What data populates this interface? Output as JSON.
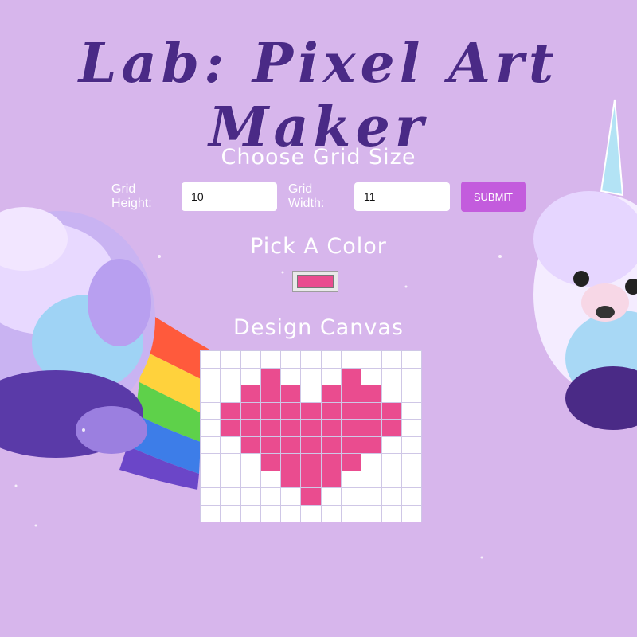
{
  "page": {
    "title": "Lab: Pixel Art Maker"
  },
  "grid_size": {
    "heading": "Choose Grid Size",
    "height_label": "Grid Height:",
    "height_value": "10",
    "width_label": "Grid Width:",
    "width_value": "11",
    "submit_label": "SUBMIT"
  },
  "color": {
    "heading": "Pick A Color",
    "selected": "#ea4c8f"
  },
  "canvas": {
    "heading": "Design Canvas",
    "rows": 10,
    "cols": 11,
    "filled_cells": [
      [
        1,
        3
      ],
      [
        1,
        7
      ],
      [
        2,
        2
      ],
      [
        2,
        3
      ],
      [
        2,
        4
      ],
      [
        2,
        6
      ],
      [
        2,
        7
      ],
      [
        2,
        8
      ],
      [
        3,
        1
      ],
      [
        3,
        2
      ],
      [
        3,
        3
      ],
      [
        3,
        4
      ],
      [
        3,
        5
      ],
      [
        3,
        6
      ],
      [
        3,
        7
      ],
      [
        3,
        8
      ],
      [
        3,
        9
      ],
      [
        4,
        1
      ],
      [
        4,
        2
      ],
      [
        4,
        3
      ],
      [
        4,
        4
      ],
      [
        4,
        5
      ],
      [
        4,
        6
      ],
      [
        4,
        7
      ],
      [
        4,
        8
      ],
      [
        4,
        9
      ],
      [
        5,
        2
      ],
      [
        5,
        3
      ],
      [
        5,
        4
      ],
      [
        5,
        5
      ],
      [
        5,
        6
      ],
      [
        5,
        7
      ],
      [
        5,
        8
      ],
      [
        6,
        3
      ],
      [
        6,
        4
      ],
      [
        6,
        5
      ],
      [
        6,
        6
      ],
      [
        6,
        7
      ],
      [
        7,
        4
      ],
      [
        7,
        5
      ],
      [
        7,
        6
      ],
      [
        8,
        5
      ]
    ]
  }
}
